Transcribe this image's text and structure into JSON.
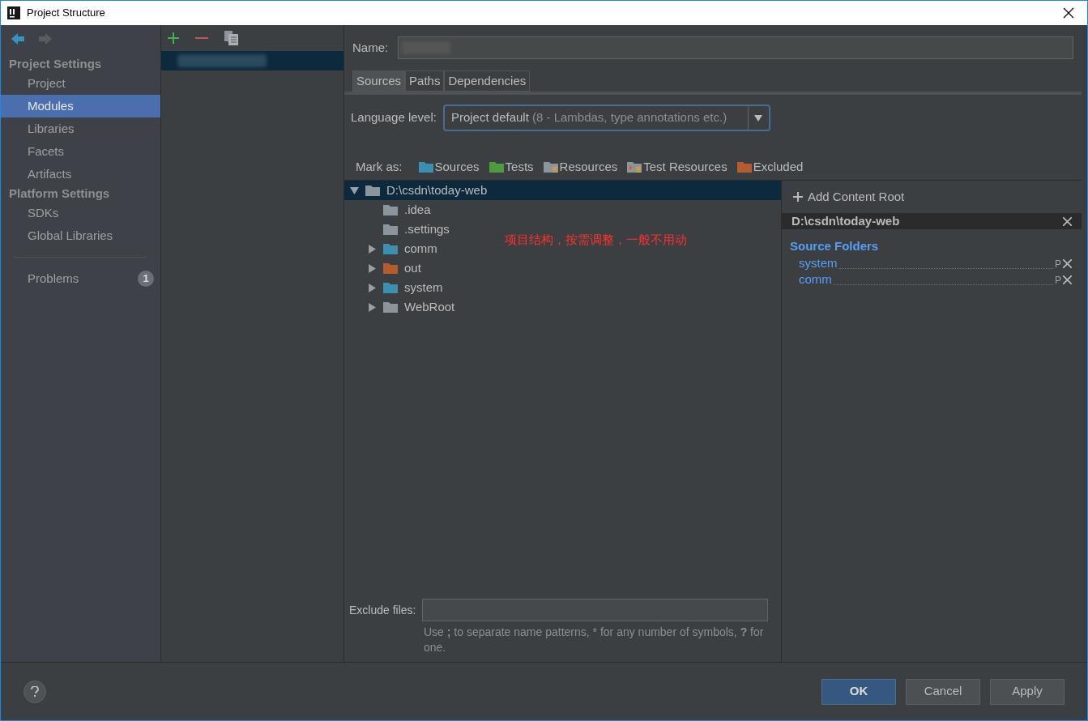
{
  "window": {
    "title": "Project Structure"
  },
  "sidebar": {
    "sections": [
      {
        "title": "Project Settings",
        "items": [
          {
            "label": "Project",
            "selected": false
          },
          {
            "label": "Modules",
            "selected": true
          },
          {
            "label": "Libraries",
            "selected": false
          },
          {
            "label": "Facets",
            "selected": false
          },
          {
            "label": "Artifacts",
            "selected": false
          }
        ]
      },
      {
        "title": "Platform Settings",
        "items": [
          {
            "label": "SDKs",
            "selected": false
          },
          {
            "label": "Global Libraries",
            "selected": false
          }
        ]
      }
    ],
    "problems": {
      "label": "Problems",
      "count": "1"
    }
  },
  "modules": [
    {
      "selected": true
    }
  ],
  "name_label": "Name:",
  "tabs": [
    {
      "label": "Sources",
      "selected": true
    },
    {
      "label": "Paths",
      "selected": false
    },
    {
      "label": "Dependencies",
      "selected": false
    }
  ],
  "language_level": {
    "label": "Language level:",
    "value": "Project default",
    "detail": "(8 - Lambdas, type annotations etc.)"
  },
  "mark_as": {
    "label": "Mark as:",
    "options": [
      {
        "label": "Sources",
        "kind": "sources"
      },
      {
        "label": "Tests",
        "kind": "tests"
      },
      {
        "label": "Resources",
        "kind": "resources"
      },
      {
        "label": "Test Resources",
        "kind": "test_resources"
      },
      {
        "label": "Excluded",
        "kind": "excluded"
      }
    ]
  },
  "tree": [
    {
      "label": "D:\\csdn\\today-web",
      "kind": "plain",
      "expanded": true,
      "selected": true,
      "children": [
        {
          "label": ".idea",
          "kind": "plain",
          "selected": false
        },
        {
          "label": ".settings",
          "kind": "plain",
          "selected": false
        },
        {
          "label": "comm",
          "kind": "sources",
          "expandable": true,
          "expanded": false,
          "selected": false
        },
        {
          "label": "out",
          "kind": "excluded",
          "expandable": true,
          "expanded": false,
          "selected": false
        },
        {
          "label": "system",
          "kind": "sources",
          "expandable": true,
          "expanded": false,
          "selected": false
        },
        {
          "label": "WebRoot",
          "kind": "plain",
          "expandable": true,
          "expanded": false,
          "selected": false
        }
      ]
    }
  ],
  "annotation": "项目结构，按需调整，一般不用动",
  "content_root": {
    "add_label": "Add Content Root",
    "path": "D:\\csdn\\today-web",
    "section": "Source Folders",
    "folders": [
      {
        "name": "system",
        "suffix": "P"
      },
      {
        "name": "comm",
        "suffix": "P"
      }
    ]
  },
  "exclude": {
    "label": "Exclude files:",
    "hint": "Use **;** to separate name patterns, * for any number of symbols, **?** for one."
  },
  "buttons": [
    {
      "label": "OK",
      "kind": "default"
    },
    {
      "label": "Cancel",
      "kind": "normal"
    },
    {
      "label": "Apply",
      "kind": "normal"
    }
  ]
}
